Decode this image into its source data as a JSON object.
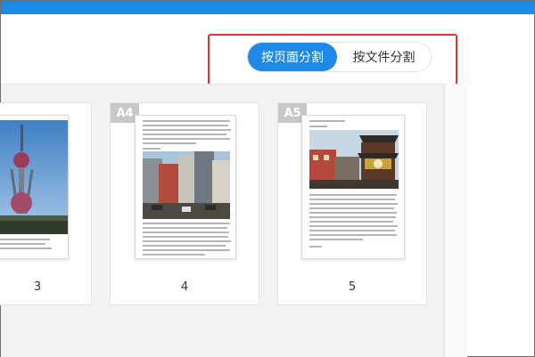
{
  "split_mode": {
    "by_page_label": "按页面分割",
    "by_file_label": "按文件分割"
  },
  "pages": [
    {
      "number": "3",
      "size_label": ""
    },
    {
      "number": "4",
      "size_label": "A4"
    },
    {
      "number": "5",
      "size_label": "A5"
    }
  ],
  "colors": {
    "accent": "#1e8ae6",
    "highlight_border": "#e0332e",
    "badge": "#c8c8c8"
  }
}
